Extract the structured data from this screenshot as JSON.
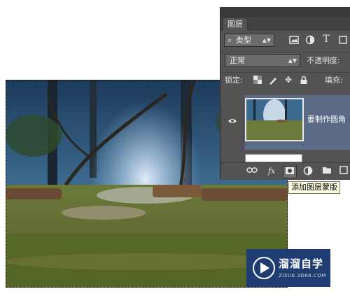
{
  "panel": {
    "tab_title": "图层",
    "filter": {
      "label": "类型",
      "icons": [
        "image-filter-icon",
        "adjustment-filter-icon",
        "type-filter-icon",
        "shape-filter-icon"
      ]
    },
    "blend_mode": "正常",
    "opacity_label": "不透明度:",
    "lock_label": "锁定:",
    "fill_label": "填充:",
    "layer": {
      "name": "要制作圆角"
    },
    "footer_icons": [
      "link-layers-icon",
      "fx-icon",
      "add-mask-icon",
      "adjustment-layer-icon",
      "new-group-icon",
      "new-layer-icon"
    ],
    "fx_text": "fx",
    "type_glyph": "T"
  },
  "tooltip": "添加图层蒙版",
  "watermark": {
    "title": "溜溜自学",
    "url": "ZIXUE.3D66.COM"
  },
  "colors": {
    "panel_bg": "#535353",
    "selected_layer": "#5b6b86",
    "tooltip_bg": "#ffffe1",
    "watermark_bg": "#1f3d72"
  }
}
